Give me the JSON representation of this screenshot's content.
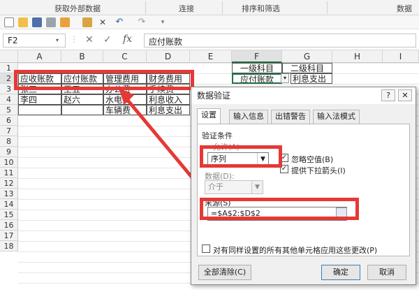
{
  "ribbon": {
    "groups": [
      "获取外部数据",
      "连接",
      "排序和筛选",
      "数据"
    ]
  },
  "qat": {
    "icons": [
      "new-file-icon",
      "open-folder-icon",
      "save-icon",
      "print-icon",
      "folder-icon",
      "close-icon",
      "undo-icon",
      "redo-icon",
      "customize-icon"
    ]
  },
  "formula_bar": {
    "name_box": "F2",
    "cancel": "✕",
    "enter": "✓",
    "fx": "fx",
    "value": "应付账款"
  },
  "columns": [
    "A",
    "B",
    "C",
    "D",
    "E",
    "F",
    "G",
    "H",
    "I"
  ],
  "rows": [
    "1",
    "2",
    "3",
    "4",
    "5",
    "6",
    "7",
    "8",
    "9",
    "10",
    "11",
    "12",
    "13",
    "14",
    "15",
    "16",
    "17",
    "18"
  ],
  "cells": {
    "A2": "应收账款",
    "B2": "应付账款",
    "C2": "管理费用",
    "D2": "财务费用",
    "A3": "张三",
    "B3": "王五",
    "C3": "办公费",
    "D3": "手续费",
    "A4": "李四",
    "B4": "赵六",
    "C4": "水电费",
    "D4": "利息收入",
    "C5": "车辆费",
    "D5": "利息支出",
    "F1": "一级科目",
    "G1": "二级科目",
    "F2": "应付账款",
    "G2": "利息支出"
  },
  "dialog": {
    "title": "数据验证",
    "help": "?",
    "close": "✕",
    "tabs": [
      "设置",
      "输入信息",
      "出错警告",
      "输入法模式"
    ],
    "section": "验证条件",
    "allow_label": "允许(A)",
    "allow_value": "序列",
    "ignore_blank": "忽略空值(B)",
    "dropdown_arrow": "提供下拉箭头(I)",
    "data_label": "数据(D):",
    "data_value": "介于",
    "source_label": "来源(S)",
    "source_value": "=$A$2:$D$2",
    "apply_all": "对有同样设置的所有其他单元格应用这些更改(P)",
    "clear_all": "全部清除(C)",
    "ok": "确定",
    "cancel": "取消"
  },
  "colors": {
    "highlight": "#e53935",
    "selection": "#217346"
  }
}
